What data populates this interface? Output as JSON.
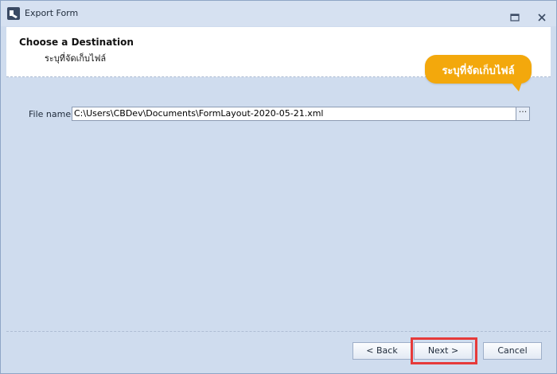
{
  "window": {
    "title": "Export Form"
  },
  "header": {
    "title": "Choose a Destination",
    "subtitle": "ระบุที่จัดเก็บไฟล์"
  },
  "tooltip": {
    "text": "ระบุที่จัดเก็บไฟล์",
    "color": "#f3a80c"
  },
  "form": {
    "file_label": "File name",
    "file_value": "C:\\Users\\CBDev\\Documents\\FormLayout-2020-05-21.xml",
    "browse_label": "···"
  },
  "footer": {
    "back_label": "< Back",
    "next_label": "Next >",
    "cancel_label": "Cancel"
  },
  "icons": {
    "app": "app-icon",
    "restore": "restore-icon",
    "close": "close-icon"
  },
  "colors": {
    "highlight": "#e63a3a",
    "background": "#cfdcee"
  }
}
